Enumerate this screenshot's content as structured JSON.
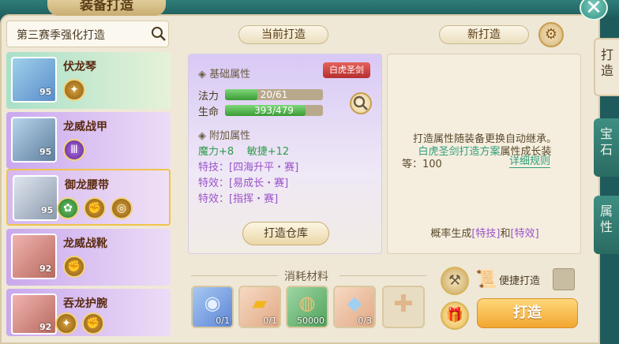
{
  "window": {
    "title": "装备打造"
  },
  "search": {
    "text": "第三赛季强化打造"
  },
  "items": [
    {
      "name": "伏龙琴",
      "level": "95"
    },
    {
      "name": "龙威战甲",
      "level": "95"
    },
    {
      "name": "御龙腰带",
      "level": "95"
    },
    {
      "name": "龙威战靴",
      "level": "92"
    },
    {
      "name": "吞龙护腕",
      "level": "92"
    }
  ],
  "tabs": {
    "current": "当前打造",
    "new": "新打造"
  },
  "base": {
    "title": "基础属性",
    "badge": "白虎圣剑",
    "stats": [
      {
        "label": "法力",
        "text": "20/61",
        "ratio": 0.33
      },
      {
        "label": "生命",
        "text": "393/479",
        "ratio": 0.82
      }
    ]
  },
  "extra": {
    "title": "附加属性",
    "line1": "魔力+8    敏捷+12",
    "line2": "特技：[四海升平・赛]",
    "line3": "特效：[易成长・赛]",
    "line4": "特效：[指挥・赛]"
  },
  "warehouse_label": "打造仓库",
  "info": {
    "line1": "打造属性随装备更换自动继承。",
    "line2_link": "白虎圣剑打造方案",
    "line2_rest": "属性成长装",
    "line3": "等：100",
    "rule_link": "详细规则",
    "bottom_pre": "概率生成",
    "bottom_link1": "[特技]",
    "bottom_mid": "和",
    "bottom_link2": "[特效]"
  },
  "materials": {
    "title": "消耗材料",
    "list": [
      {
        "count": "0/1",
        "icon": "swirl-orb-icon"
      },
      {
        "count": "0/1",
        "icon": "gold-scroll-icon"
      },
      {
        "count": "50000",
        "icon": "coin-icon"
      },
      {
        "count": "0/3",
        "icon": "crystal-icon"
      }
    ]
  },
  "quick_forge_label": "便捷打造",
  "forge_label": "打造",
  "side_tabs": [
    "打\n造",
    "宝\n石",
    "属\n性"
  ],
  "colors": {
    "accent": "#f2a62f",
    "link": "#2f9d7a",
    "purple_text": "#9a52c8"
  }
}
